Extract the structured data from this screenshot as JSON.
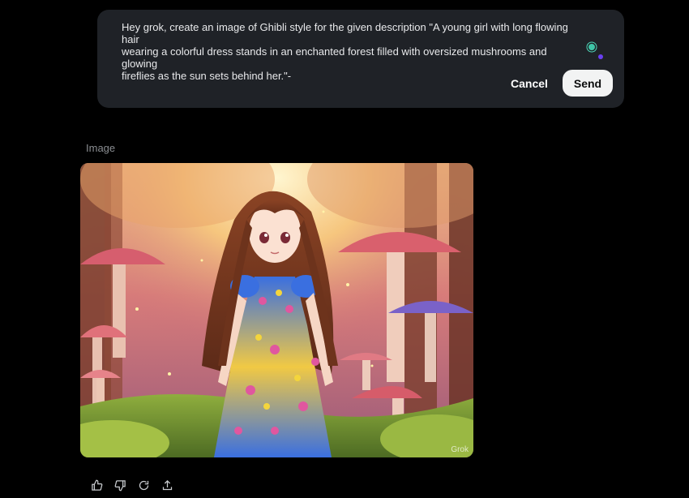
{
  "prompt_editor": {
    "text": "Hey grok, create an image of Ghibli style for the given description \"A young girl with long flowing hair\nwearing a colorful dress stands in an enchanted forest filled with oversized mushrooms and glowing\nfireflies as the sun sets behind her.\"-",
    "cancel_label": "Cancel",
    "send_label": "Send"
  },
  "response": {
    "section_label": "Image",
    "watermark": "Grok"
  },
  "actions": [
    "thumbs-up-icon",
    "thumbs-down-icon",
    "regenerate-icon",
    "share-icon"
  ]
}
